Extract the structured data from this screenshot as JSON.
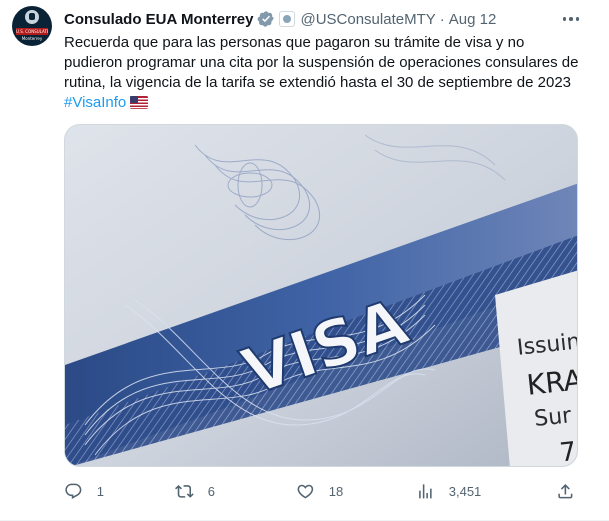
{
  "author": {
    "name": "Consulado EUA Monterrey",
    "handle": "@USConsulateMTY",
    "separator": "·",
    "date": "Aug 12",
    "avatar_band_text": "U.S. CONSULATE",
    "avatar_sub_text": "Monterrey"
  },
  "tweet": {
    "text": "Recuerda que para las personas que pagaron su trámite de visa y no pudieron programar una cita por la suspensión de operaciones consulares de rutina, la vigencia de la tarifa se extendió hasta el 30 de septiembre de 2023",
    "hashtag": "#VisaInfo"
  },
  "media": {
    "visa_word": "VISA",
    "issuing_lines": [
      "Issuin",
      "KRA",
      "Sur",
      "7"
    ]
  },
  "actions": {
    "reply_count": "1",
    "retweet_count": "6",
    "like_count": "18",
    "views_count": "3,451"
  },
  "icons": {
    "verified": "verified-badge-icon",
    "affiliation": "government-seal-icon",
    "flag": "us-flag-emoji",
    "more": "more-options-icon",
    "reply": "reply-icon",
    "retweet": "retweet-icon",
    "like": "heart-icon",
    "views": "views-chart-icon",
    "share": "share-icon"
  },
  "colors": {
    "accent": "#1d9bf0",
    "verified_grey": "#829aab",
    "text_primary": "#0f1419",
    "text_secondary": "#536471"
  }
}
